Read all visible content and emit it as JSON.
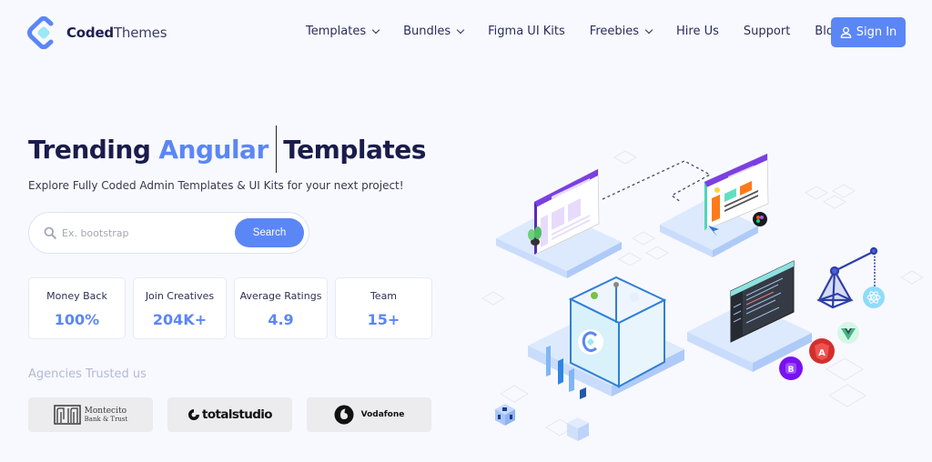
{
  "header": {
    "logo": {
      "bold": "Coded",
      "light": "Themes",
      "icon": "coded-themes-logo-icon"
    },
    "nav": [
      {
        "label": "Templates",
        "dropdown": true
      },
      {
        "label": "Bundles",
        "dropdown": true
      },
      {
        "label": "Figma UI Kits",
        "dropdown": false
      },
      {
        "label": "Freebies",
        "dropdown": true
      },
      {
        "label": "Hire Us",
        "dropdown": false
      },
      {
        "label": "Support",
        "dropdown": false
      },
      {
        "label": "Blog",
        "dropdown": false
      }
    ],
    "signin": {
      "label": "Sign In",
      "icon": "user-icon"
    }
  },
  "hero": {
    "title_start": "Trending",
    "title_accent": "Angular",
    "title_end": "Templates",
    "subtitle": "Explore Fully Coded Admin Templates & UI Kits for your next project!",
    "search": {
      "placeholder": "Ex. bootstrap",
      "value": "",
      "button_label": "Search",
      "icon": "search-icon"
    }
  },
  "stats": [
    {
      "label": "Money Back",
      "value": "100%"
    },
    {
      "label": "Join Creatives",
      "value": "204K+"
    },
    {
      "label": "Average Ratings",
      "value": "4.9"
    },
    {
      "label": "Team",
      "value": "15+"
    }
  ],
  "agencies": {
    "title": "Agencies Trusted us",
    "brands": [
      {
        "name": "Montecito",
        "sub": "Bank & Trust"
      },
      {
        "name": "totalstudio"
      },
      {
        "name": "Vodafone"
      }
    ]
  },
  "illustration": {
    "badges": [
      "react-icon",
      "vue-icon",
      "angular-icon",
      "bootstrap-icon",
      "figma-icon"
    ],
    "badge_labels": {
      "angular": "A",
      "bootstrap": "B"
    }
  },
  "colors": {
    "accent": "#5b86f5",
    "heading": "#1a1c4b",
    "background": "#f8f9fe"
  }
}
